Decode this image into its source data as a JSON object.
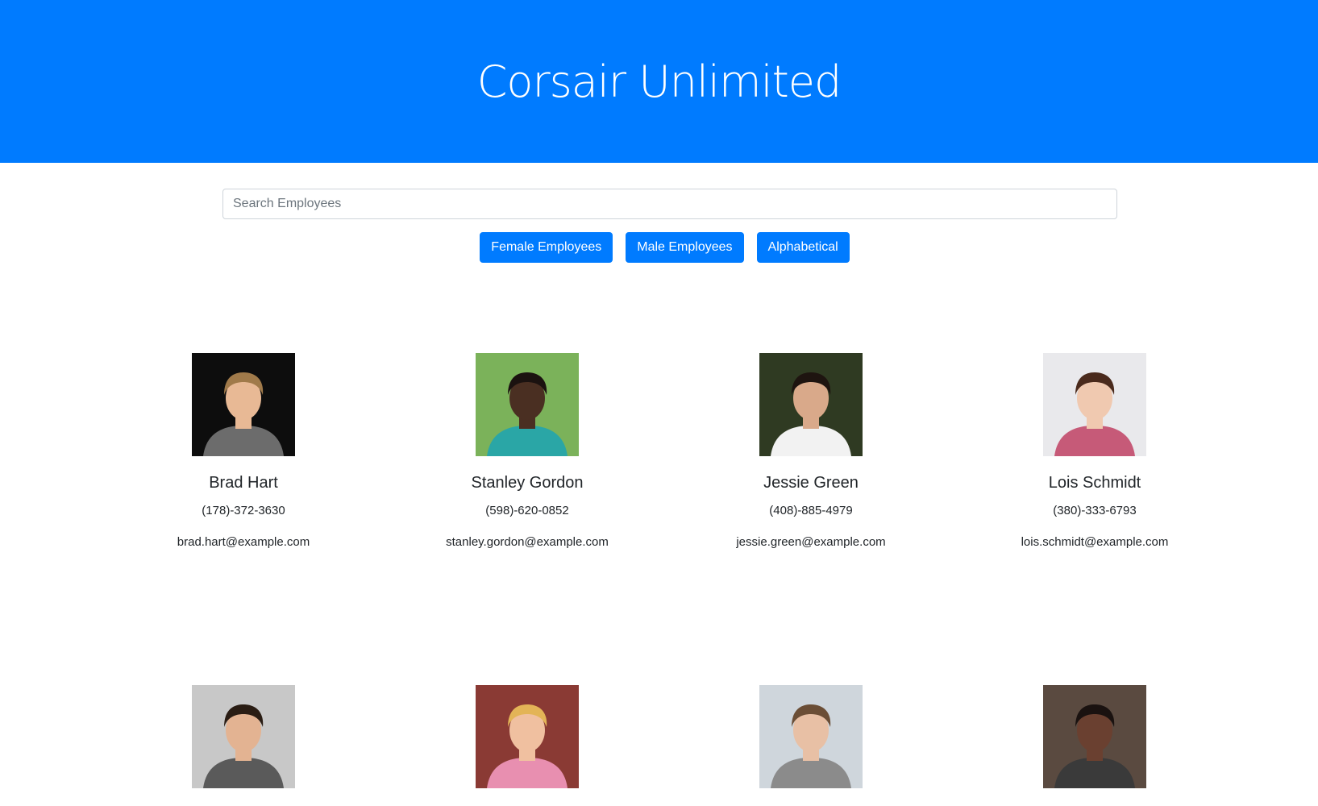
{
  "header": {
    "title": "Corsair Unlimited"
  },
  "search": {
    "placeholder": "Search Employees",
    "value": ""
  },
  "filters": {
    "female_label": "Female Employees",
    "male_label": "Male Employees",
    "alpha_label": "Alphabetical"
  },
  "employees": [
    {
      "name": "Brad Hart",
      "phone": "(178)-372-3630",
      "email": "brad.hart@example.com",
      "bg": "#0d0d0d",
      "skin": "#e8b995",
      "hair": "#a07a4a",
      "shirt": "#6c6c6c"
    },
    {
      "name": "Stanley Gordon",
      "phone": "(598)-620-0852",
      "email": "stanley.gordon@example.com",
      "bg": "#7bb25a",
      "skin": "#4a2f22",
      "hair": "#1b1210",
      "shirt": "#2aa6a6"
    },
    {
      "name": "Jessie Green",
      "phone": "(408)-885-4979",
      "email": "jessie.green@example.com",
      "bg": "#2f3a22",
      "skin": "#d9a98a",
      "hair": "#1e1410",
      "shirt": "#f2f2f2"
    },
    {
      "name": "Lois Schmidt",
      "phone": "(380)-333-6793",
      "email": "lois.schmidt@example.com",
      "bg": "#e9e9ec",
      "skin": "#f0c9b0",
      "hair": "#4a2a1c",
      "shirt": "#c65a78"
    },
    {
      "name": "",
      "phone": "",
      "email": "",
      "bg": "#c8c8c8",
      "skin": "#e3b392",
      "hair": "#2a1d14",
      "shirt": "#5a5a5a"
    },
    {
      "name": "",
      "phone": "",
      "email": "",
      "bg": "#8a3a34",
      "skin": "#f0c0a0",
      "hair": "#e3b457",
      "shirt": "#e88fb0"
    },
    {
      "name": "",
      "phone": "",
      "email": "",
      "bg": "#cfd6dc",
      "skin": "#e8c0a5",
      "hair": "#6b4e36",
      "shirt": "#8b8b8b"
    },
    {
      "name": "",
      "phone": "",
      "email": "",
      "bg": "#5a4a40",
      "skin": "#6a4030",
      "hair": "#1a1210",
      "shirt": "#3a3a3a"
    }
  ]
}
